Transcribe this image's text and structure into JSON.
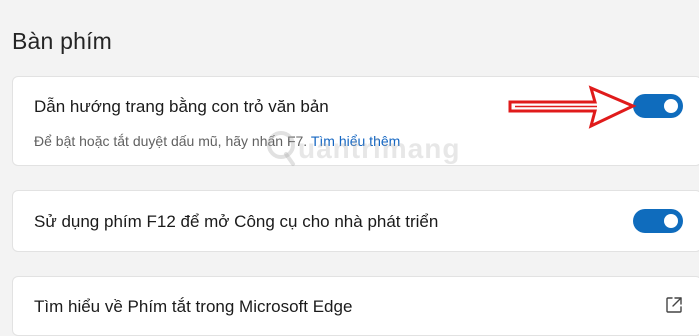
{
  "section": {
    "title": "Bàn phím"
  },
  "settings": [
    {
      "title": "Dẫn hướng trang bằng con trỏ văn bản",
      "description": "Để bật hoặc tắt duyệt dấu mũ, hãy nhấn F7.",
      "link": "Tìm hiểu thêm",
      "enabled": true
    },
    {
      "title": "Sử dụng phím F12 để mở Công cụ cho nhà phát triển",
      "enabled": true
    },
    {
      "title": "Tìm hiểu về Phím tắt trong Microsoft Edge",
      "icon": "external-link-icon"
    }
  ],
  "annotation": {
    "arrow_color": "#e01b1b",
    "icon": "red-arrow-right"
  },
  "watermark": {
    "text": "uantrimang"
  },
  "colors": {
    "accent": "#0f6cbd",
    "link": "#1466c2",
    "background": "#f3f3f3",
    "card": "#ffffff"
  }
}
